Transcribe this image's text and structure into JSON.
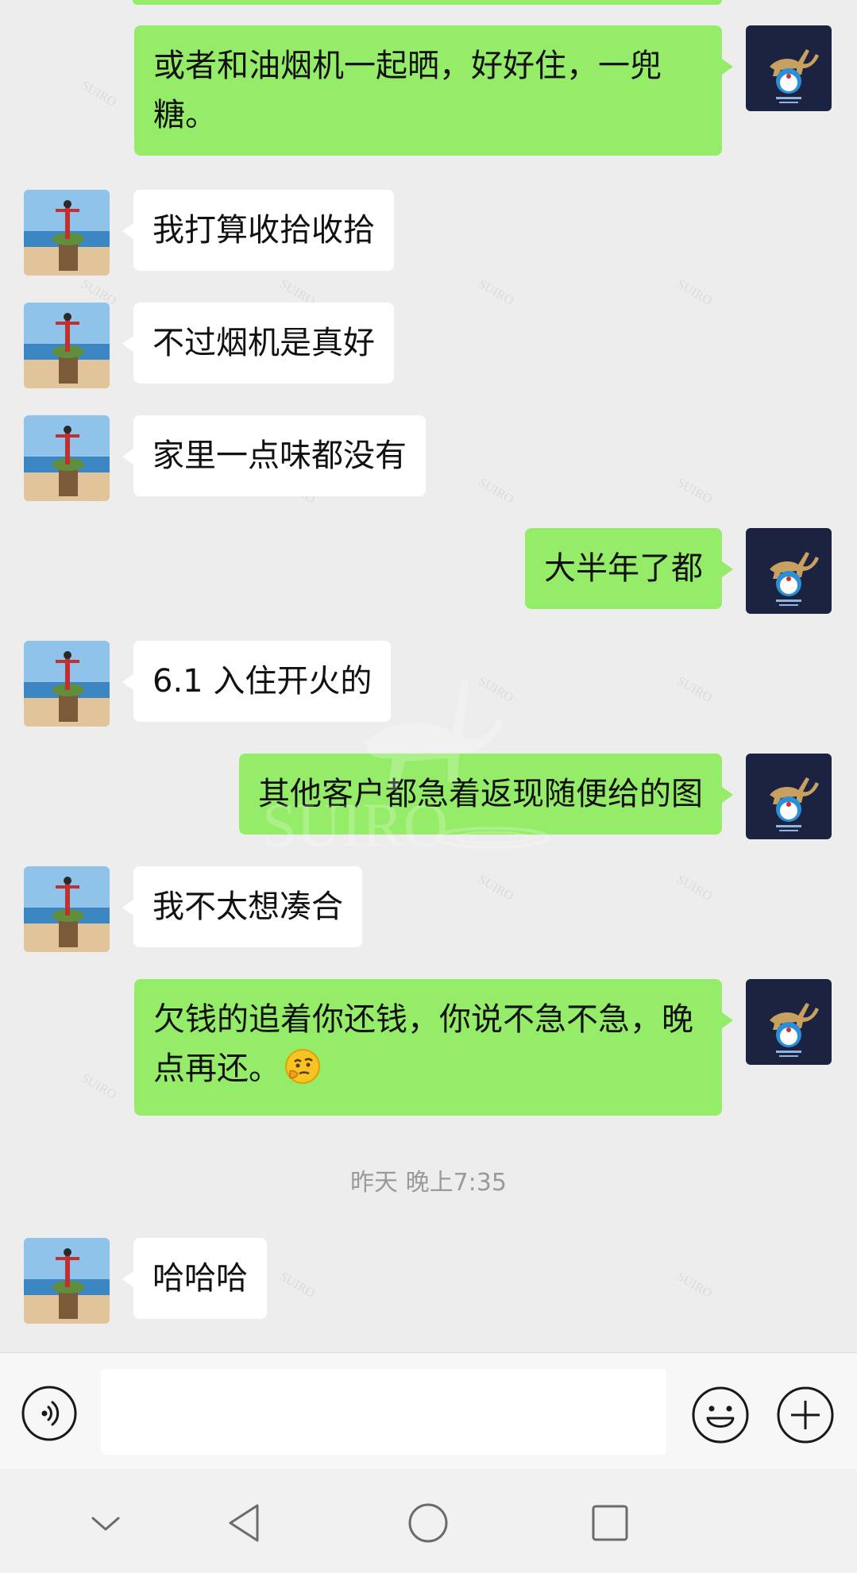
{
  "colors": {
    "chat_background": "#ededed",
    "outgoing_bubble": "#95ec69",
    "incoming_bubble": "#ffffff",
    "timestamp_text": "#9a9a9a"
  },
  "messages": [
    {
      "side": "out",
      "text": "或者和油烟机一起晒，好好住，一兜糖。"
    },
    {
      "side": "in",
      "text": "我打算收拾收拾"
    },
    {
      "side": "in",
      "text": "不过烟机是真好"
    },
    {
      "side": "in",
      "text": "家里一点味都没有"
    },
    {
      "side": "out",
      "text": "大半年了都"
    },
    {
      "side": "in",
      "text": "6.1 入住开火的"
    },
    {
      "side": "out",
      "text": "其他客户都急着返现随便给的图"
    },
    {
      "side": "in",
      "text": "我不太想凑合"
    },
    {
      "side": "out",
      "text": "欠钱的追着你还钱，你说不急不急，晚点再还。",
      "emoji": "thinking-face"
    },
    {
      "side": "in",
      "text": "哈哈哈"
    }
  ],
  "timestamp": "昨天 晚上7:35",
  "watermark": "SUIRO",
  "input_bar": {
    "voice_icon": "voice-icon",
    "emoji_icon": "smiley-icon",
    "plus_icon": "plus-icon",
    "placeholder": ""
  },
  "nav_bar": {
    "icons": [
      "chevron-down-icon",
      "back-triangle-icon",
      "home-circle-icon",
      "recents-square-icon"
    ]
  }
}
